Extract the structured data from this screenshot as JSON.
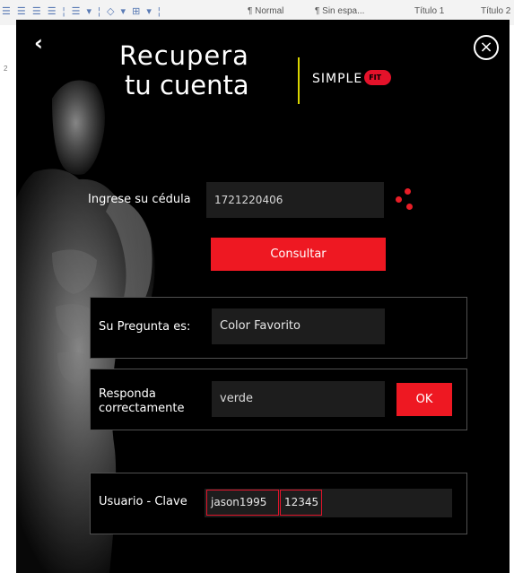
{
  "background_app": {
    "styles": [
      "¶ Normal",
      "¶ Sin espa...",
      "Título 1",
      "Título 2"
    ]
  },
  "dialog": {
    "back_icon": "chevron-left-icon",
    "close_icon": "close-icon",
    "title_line1": "Recupera",
    "title_line2": "tu cuenta",
    "brand_name": "SIMPLE",
    "brand_badge": "FIT",
    "accent_color": "#ee1822",
    "cedula": {
      "label": "Ingrese su cédula",
      "value": "1721220406"
    },
    "consultar_label": "Consultar",
    "question": {
      "label": "Su Pregunta es:",
      "value": "Color Favorito"
    },
    "answer": {
      "label_line1": "Responda",
      "label_line2": "correctamente",
      "value": "verde",
      "ok_label": "OK"
    },
    "credentials": {
      "label": "Usuario - Clave",
      "user": "jason1995",
      "password": "12345"
    }
  }
}
